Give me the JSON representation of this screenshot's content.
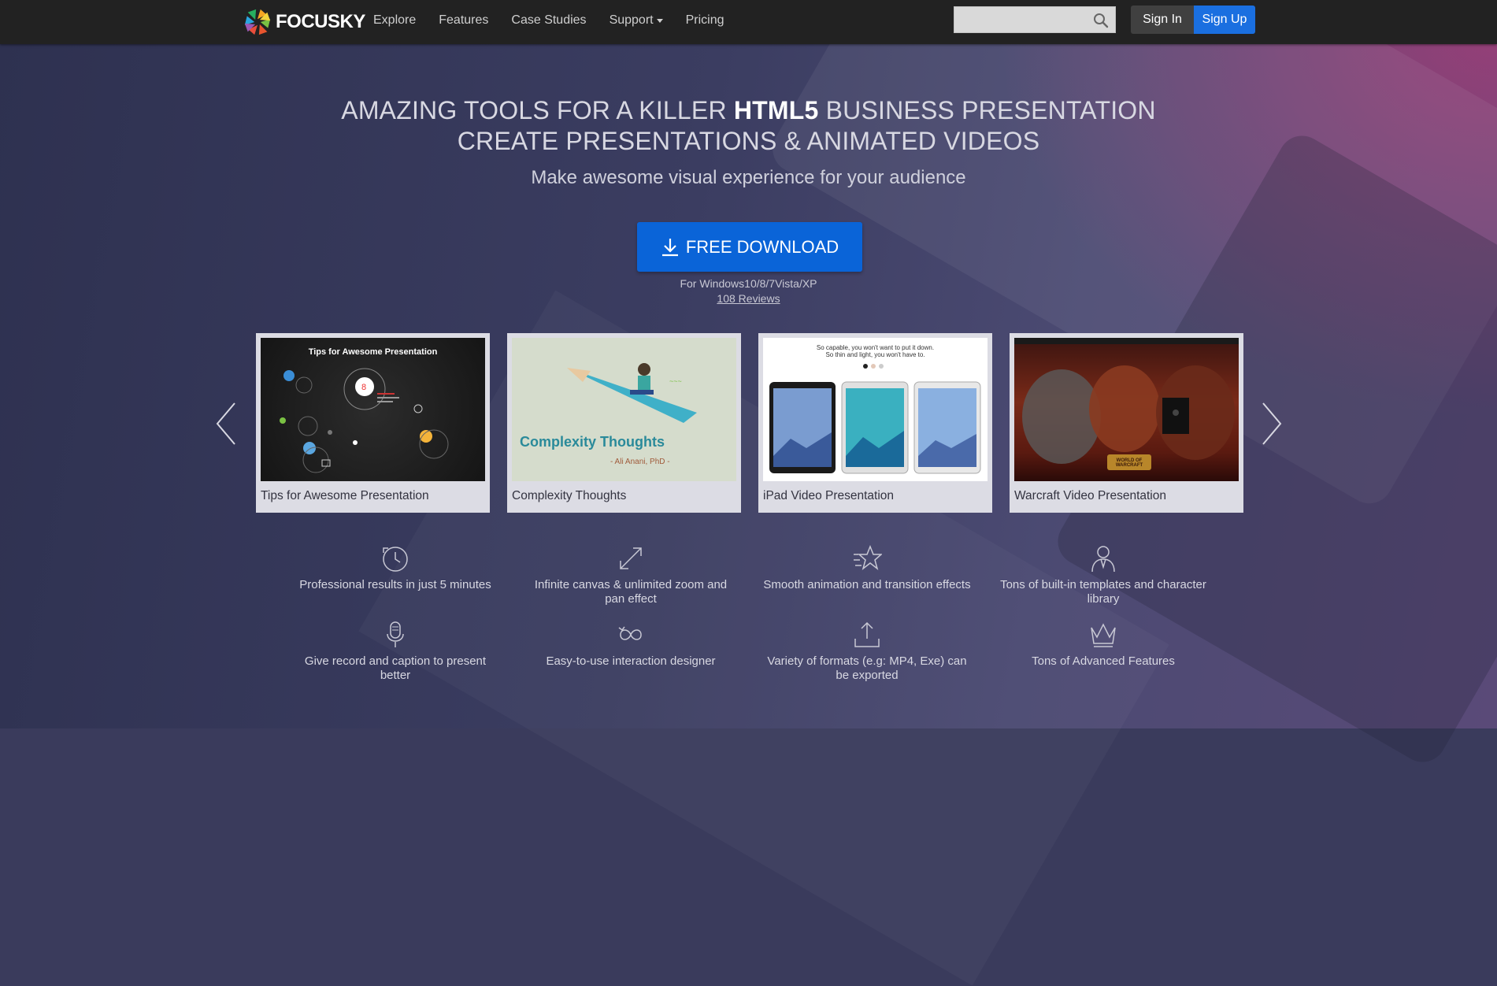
{
  "brand": {
    "name": "FOCUSKY"
  },
  "nav": {
    "links": [
      "Explore",
      "Features",
      "Case Studies",
      "Support",
      "Pricing"
    ],
    "search_placeholder": "",
    "signin_label": "Sign In",
    "signup_label": "Sign Up"
  },
  "hero": {
    "line1_prefix": "AMAZING TOOLS FOR A KILLER ",
    "line1_bold": "HTML5",
    "line1_suffix": " BUSINESS PRESENTATION",
    "line2": "CREATE PRESENTATIONS & ANIMATED VIDEOS",
    "subtitle": "Make awesome visual experience for your audience",
    "download_label": "FREE DOWNLOAD",
    "platform": "For Windows10/8/7Vista/XP",
    "reviews": "108 Reviews"
  },
  "carousel": {
    "cards": [
      {
        "caption": "Tips for Awesome Presentation",
        "thumb_title": "Tips for Awesome Presentation"
      },
      {
        "caption": "Complexity Thoughts",
        "thumb_title": "Complexity Thoughts",
        "thumb_author": "- Ali Anani, PhD -"
      },
      {
        "caption": "iPad Video Presentation",
        "thumb_line1": "So capable, you won't want to put it down.",
        "thumb_line2": "So thin and light, you won't have to."
      },
      {
        "caption": "Warcraft Video Presentation",
        "thumb_logo": "WORLD OF WARCRAFT"
      }
    ]
  },
  "features": [
    {
      "icon": "clock-icon",
      "text": "Professional results in just 5 minutes"
    },
    {
      "icon": "expand-icon",
      "text": "Infinite canvas & unlimited zoom and pan effect"
    },
    {
      "icon": "star-icon",
      "text": "Smooth animation and transition effects"
    },
    {
      "icon": "character-icon",
      "text": "Tons of built-in templates and character library"
    },
    {
      "icon": "microphone-icon",
      "text": "Give record and caption to present better"
    },
    {
      "icon": "interaction-icon",
      "text": "Easy-to-use interaction designer"
    },
    {
      "icon": "export-icon",
      "text": "Variety of formats (e.g: MP4, Exe) can be exported"
    },
    {
      "icon": "crown-icon",
      "text": "Tons of Advanced Features"
    }
  ],
  "colors": {
    "nav_bg": "#222222",
    "accent": "#0a64d8",
    "signup": "#1a6fe0"
  }
}
